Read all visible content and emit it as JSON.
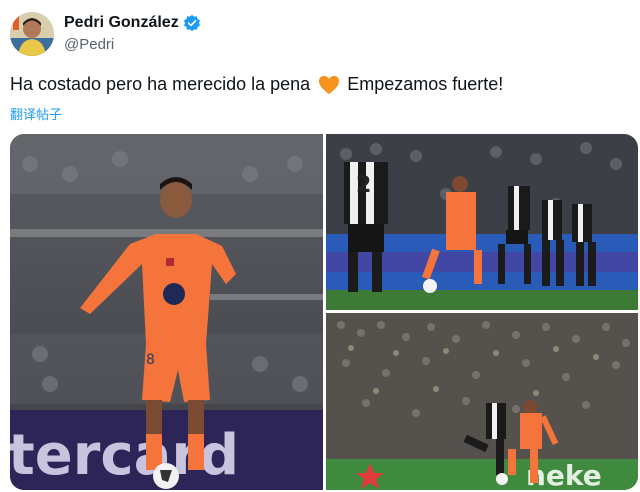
{
  "author": {
    "name": "Pedri González",
    "handle": "@Pedri",
    "verified": true,
    "avatar_icon": "profile-photo-icon"
  },
  "tweet": {
    "text_before": "Ha costado pero ha merecido la pena",
    "emoji": "orange-heart-icon",
    "text_after": "Empezamos fuerte!",
    "translate_label": "翻译帖子"
  },
  "media": {
    "count": 3,
    "photo_1": {
      "kit_number": "8",
      "ad_board_text": "tercard"
    },
    "photo_2": {
      "opponent_number": "2"
    },
    "photo_3": {
      "ad_board_text": "neke"
    }
  },
  "colors": {
    "accent": "#1d9bf0",
    "text": "#0f1419",
    "secondary_text": "#536471",
    "kit_orange": "#f4743b",
    "heart": "#f7931e"
  }
}
